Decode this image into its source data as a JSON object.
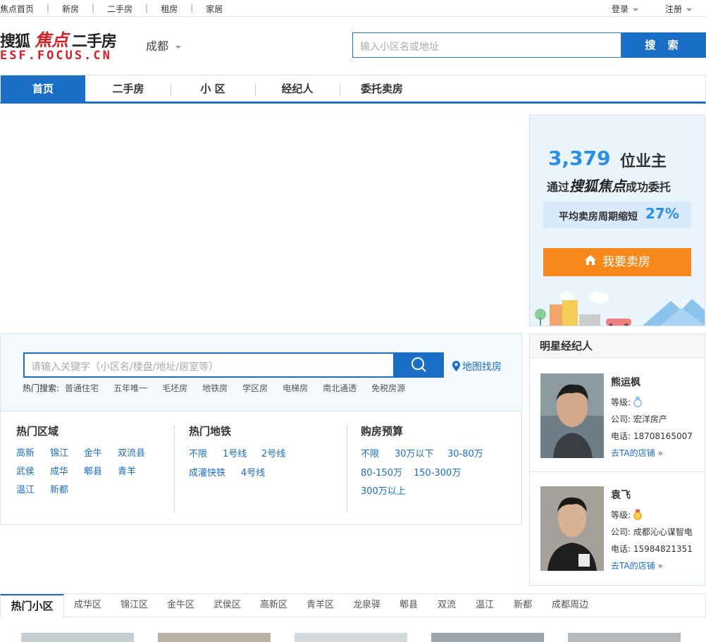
{
  "topbar": {
    "links": [
      "焦点首页",
      "新房",
      "二手房",
      "租房",
      "家居"
    ],
    "separator": "|",
    "login": "登录",
    "register": "注册"
  },
  "header": {
    "logo_sohu": "搜狐",
    "logo_focus": "焦点",
    "logo_esf": "二手房",
    "logo_domain": "ESF.FOCUS.CN",
    "city": "成都",
    "search_placeholder": "输入小区名或地址",
    "search_button": "搜 索"
  },
  "nav": {
    "items": [
      "首页",
      "二手房",
      "小 区",
      "经纪人",
      "委托卖房"
    ],
    "active_index": 0
  },
  "promo": {
    "count": "3,379",
    "count_unit": "位业主",
    "sub_prefix": "通过",
    "sub_brand": "搜狐焦点",
    "sub_suffix": "成功委托",
    "cycle_text": "平均卖房周期缩短",
    "cycle_pct": "27%",
    "sell_button": "我要卖房"
  },
  "search_panel": {
    "placeholder": "请输入关键字（小区名/楼盘/地址/居室等）",
    "map_search": "地图找房",
    "hot_label": "热门搜索:",
    "hot_tags": [
      "普通住宅",
      "五年唯一",
      "毛坯房",
      "地铁房",
      "学区房",
      "电梯房",
      "南北通透",
      "免税房源"
    ],
    "areas_title": "热门区域",
    "areas": [
      "高新",
      "锦江",
      "金牛",
      "双流县",
      "武侯",
      "成华",
      "郫县",
      "青羊",
      "温江",
      "新都"
    ],
    "metro_title": "热门地铁",
    "metro": [
      "不限",
      "1号线",
      "2号线",
      "成灌快铁",
      "4号线"
    ],
    "budget_title": "购房预算",
    "budget": [
      "不限",
      "30万以下",
      "30-80万",
      "80-150万",
      "150-300万",
      "300万以上"
    ]
  },
  "agents": {
    "title": "明星经纪人",
    "level_label": "等级:",
    "company_label": "公司:",
    "phone_label": "电话:",
    "shop_link": "去TA的店铺 »",
    "list": [
      {
        "name": "熊运枫",
        "company": "宏洋房产",
        "phone": "18708165007",
        "medal_color": "#7fb8e6"
      },
      {
        "name": "袁飞",
        "company": "成都沁心谋智电",
        "phone": "15984821351",
        "medal_color": "#f0a020"
      }
    ]
  },
  "hot_communities": {
    "title": "热门小区",
    "tabs": [
      "成华区",
      "锦江区",
      "金牛区",
      "武侯区",
      "高新区",
      "青羊区",
      "龙泉驿",
      "郫县",
      "双流",
      "温江",
      "新都",
      "成都周边"
    ]
  },
  "colors": {
    "primary_blue": "#1a6ec5",
    "brand_red": "#d51f27",
    "orange": "#f7891c",
    "highlight_blue": "#2a8ee5"
  }
}
